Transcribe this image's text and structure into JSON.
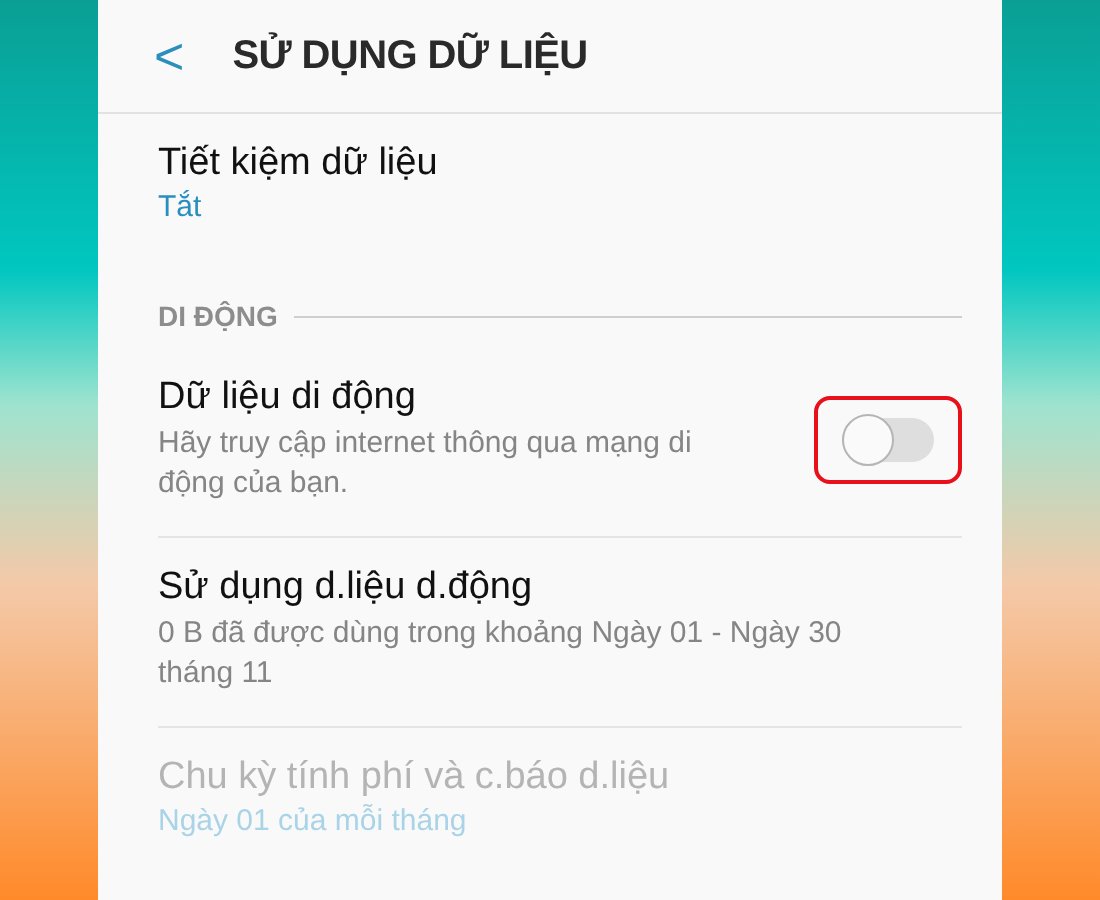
{
  "header": {
    "back": "<",
    "title": "SỬ DỤNG DỮ LIỆU"
  },
  "sections": [
    {
      "items": [
        {
          "kind": "plain",
          "title": "Tiết kiệm dữ liệu",
          "value": "Tắt",
          "disabled": false
        }
      ]
    },
    {
      "heading": "DI ĐỘNG",
      "items": [
        {
          "kind": "toggle",
          "title": "Dữ liệu di động",
          "description": "Hãy truy cập internet thông qua mạng di động của bạn.",
          "on": false,
          "highlighted": true,
          "disabled": false
        },
        {
          "kind": "plain",
          "title": "Sử dụng d.liệu d.động",
          "description": "0 B đã được dùng trong khoảng Ngày 01 - Ngày 30 tháng 11",
          "disabled": false
        },
        {
          "kind": "plain",
          "title": "Chu kỳ tính phí và c.báo d.liệu",
          "value": "Ngày 01 của mỗi tháng",
          "disabled": true
        }
      ]
    }
  ]
}
